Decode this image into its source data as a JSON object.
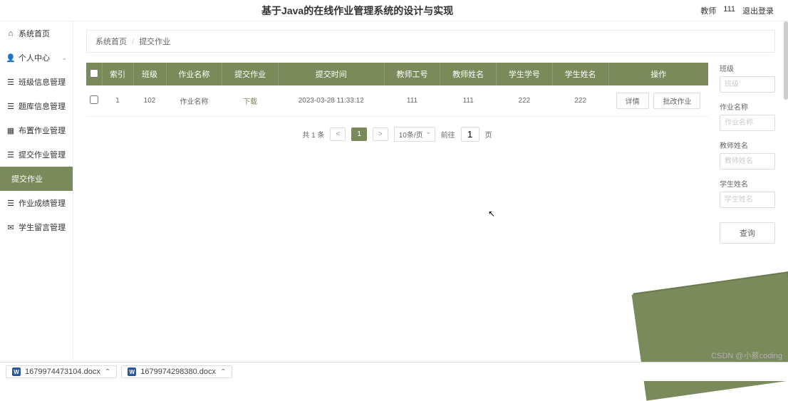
{
  "header": {
    "title": "基于Java的在线作业管理系统的设计与实现",
    "user_role": "教师",
    "user_id": "111",
    "logout": "退出登录"
  },
  "sidebar": {
    "items": [
      {
        "icon": "home",
        "label": "系统首页",
        "expandable": false
      },
      {
        "icon": "user",
        "label": "个人中心",
        "expandable": true
      },
      {
        "icon": "list",
        "label": "班级信息管理",
        "expandable": true
      },
      {
        "icon": "list",
        "label": "题库信息管理",
        "expandable": true
      },
      {
        "icon": "grid",
        "label": "布置作业管理",
        "expandable": true
      },
      {
        "icon": "list",
        "label": "提交作业管理",
        "expandable": true
      },
      {
        "icon": "",
        "label": "提交作业",
        "expandable": false,
        "active": true
      },
      {
        "icon": "list",
        "label": "作业成绩管理",
        "expandable": true
      },
      {
        "icon": "chat",
        "label": "学生留言管理",
        "expandable": true
      }
    ]
  },
  "breadcrumb": {
    "home": "系统首页",
    "current": "提交作业"
  },
  "table": {
    "headers": [
      "",
      "索引",
      "班级",
      "作业名称",
      "提交作业",
      "提交时间",
      "教师工号",
      "教师姓名",
      "学生学号",
      "学生姓名",
      "操作"
    ],
    "rows": [
      {
        "index": "1",
        "class": "102",
        "name": "作业名称",
        "submit": "下载",
        "time": "2023-03-28 11:33:12",
        "teacher_id": "111",
        "teacher_name": "111",
        "student_id": "222",
        "student_name": "222",
        "op_detail": "详情",
        "op_grade": "批改作业"
      }
    ]
  },
  "pagination": {
    "total": "共 1 条",
    "prev": "<",
    "current": "1",
    "next": ">",
    "page_size": "10条/页",
    "goto_label": "前往",
    "goto_value": "1",
    "goto_suffix": "页"
  },
  "filter": {
    "class_label": "班级",
    "class_ph": "班级",
    "name_label": "作业名称",
    "name_ph": "作业名称",
    "teacher_label": "教师姓名",
    "teacher_ph": "教师姓名",
    "student_label": "学生姓名",
    "student_ph": "学生姓名",
    "query": "查询"
  },
  "downloads": {
    "file1": "1679974473104.docx",
    "file2": "1679974298380.docx"
  },
  "watermark": "CSDN @小蔡coding"
}
